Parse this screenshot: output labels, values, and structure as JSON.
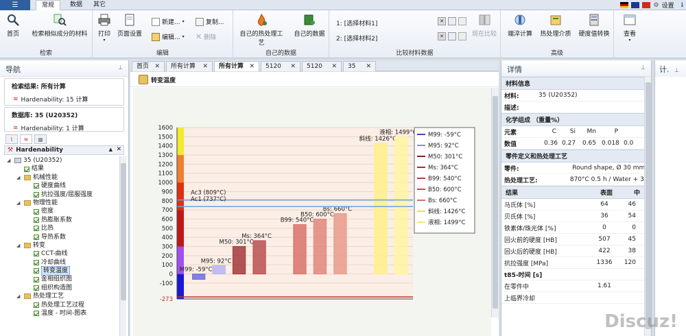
{
  "ribbon_tabs": [
    "常规",
    "数据",
    "其它"
  ],
  "settings_label": "设置",
  "groups": {
    "search": {
      "title": "检索",
      "home": "首页",
      "similar": "检索相似成分的材料"
    },
    "edit": {
      "title": "编辑",
      "print": "打印",
      "page_setup": "页面设置",
      "new": "新建...",
      "copy": "复制...",
      "edit": "编辑...",
      "delete": "删除"
    },
    "mydata": {
      "title": "自己的数据",
      "my_process": "自己的热处理工艺",
      "my_data": "自己的数据"
    },
    "compare": {
      "title": "比较材料数据",
      "slot1": "1: [选择材料1]",
      "slot2": "2: [选择材料2]",
      "compare_now": "现在比较"
    },
    "advanced": {
      "title": "高级",
      "quench": "端淬计算",
      "medium": "热处理介质",
      "hardness": "硬度值转换"
    },
    "view": {
      "label": "查看"
    }
  },
  "nav": {
    "title": "导航",
    "search_result_title": "检索结果: 所有计算",
    "search_result_item": "Hardenability: 15 计算",
    "db_title": "数据库: 35 (U20352)",
    "db_item": "Hardenability: 1 计算",
    "tree_header": "Hardenability",
    "tree": [
      {
        "level": 0,
        "type": "doc",
        "label": "35 (U20352)",
        "exp": "◢"
      },
      {
        "level": 1,
        "type": "cb",
        "label": "结果"
      },
      {
        "level": 1,
        "type": "folder",
        "label": "机械性能",
        "exp": "◢"
      },
      {
        "level": 2,
        "type": "cb",
        "label": "硬度曲线"
      },
      {
        "level": 2,
        "type": "cb",
        "label": "抗拉强度/屈服强度"
      },
      {
        "level": 1,
        "type": "folder",
        "label": "物理性能",
        "exp": "◢"
      },
      {
        "level": 2,
        "type": "cb",
        "label": "密度"
      },
      {
        "level": 2,
        "type": "cb",
        "label": "热膨胀系数"
      },
      {
        "level": 2,
        "type": "cb",
        "label": "比热"
      },
      {
        "level": 2,
        "type": "cb",
        "label": "导热系数"
      },
      {
        "level": 1,
        "type": "folder",
        "label": "转变",
        "exp": "◢"
      },
      {
        "level": 2,
        "type": "cb",
        "label": "CCT-曲线"
      },
      {
        "level": 2,
        "type": "cb",
        "label": "冷却曲线"
      },
      {
        "level": 2,
        "type": "cb",
        "label": "转变温度",
        "selected": true
      },
      {
        "level": 2,
        "type": "cb",
        "label": "金相组织图"
      },
      {
        "level": 2,
        "type": "cb",
        "label": "组织构造图"
      },
      {
        "level": 1,
        "type": "folder",
        "label": "热处理工艺",
        "exp": "◢"
      },
      {
        "level": 2,
        "type": "cb",
        "label": "热处理工艺过程"
      },
      {
        "level": 2,
        "type": "cb",
        "label": "温度 - 时间-图表"
      }
    ]
  },
  "doc_tabs": [
    {
      "label": "首页",
      "active": false
    },
    {
      "label": "所有计算",
      "active": false
    },
    {
      "label": "所有计算",
      "active": true
    },
    {
      "label": "5120",
      "active": false
    },
    {
      "label": "5120",
      "active": false
    },
    {
      "label": "35",
      "active": false
    }
  ],
  "content_title": "转变温度",
  "chart_data": {
    "type": "bar",
    "ylim": [
      -273,
      1600
    ],
    "yticks": [
      -273,
      -100,
      0,
      100,
      200,
      300,
      400,
      500,
      600,
      700,
      800,
      900,
      1000,
      1100,
      1200,
      1300,
      1400,
      1500,
      1600
    ],
    "bars": [
      {
        "name": "M99",
        "value": -59,
        "color": "#6d6ee0",
        "label": "M99: -59°C"
      },
      {
        "name": "M95",
        "value": 92,
        "color": "#b8b4f0",
        "label": "M95: 92°C"
      },
      {
        "name": "M50",
        "value": 301,
        "color": "#a23a3a",
        "label": "M50: 301°C"
      },
      {
        "name": "Ms",
        "value": 364,
        "color": "#b85050",
        "label": "Ms: 364°C"
      },
      {
        "name": "B99",
        "value": 540,
        "color": "#d8736a",
        "label": "B99: 540°C"
      },
      {
        "name": "B50",
        "value": 600,
        "color": "#e0877c",
        "label": "B50: 600°C"
      },
      {
        "name": "Bs",
        "value": 660,
        "color": "#e89a8a",
        "label": "Bs: 660°C"
      },
      {
        "name": "斜线",
        "value": 1426,
        "color": "#fff08a",
        "label": "斜线: 1426°C"
      },
      {
        "name": "液相",
        "value": 1499,
        "color": "#fff4a0",
        "label": "液相: 1499°C"
      }
    ],
    "reference_lines": [
      {
        "label": "Ac3 (809°C)",
        "value": 809,
        "color": "#6ea0e0"
      },
      {
        "label": "Ac1 (737°C)",
        "value": 737,
        "color": "#6ea0e0"
      }
    ],
    "zero_line_color": "#d02a2a",
    "legend": [
      {
        "label": "M99: -59°C",
        "color": "#4444cc"
      },
      {
        "label": "M95: 92°C",
        "color": "#8888dd"
      },
      {
        "label": "M50: 301°C",
        "color": "#8a2020"
      },
      {
        "label": "Ms: 364°C",
        "color": "#a03030"
      },
      {
        "label": "B99: 540°C",
        "color": "#b04040"
      },
      {
        "label": "B50: 600°C",
        "color": "#c05050"
      },
      {
        "label": "Bs: 660°C",
        "color": "#d07060"
      },
      {
        "label": "斜线: 1426°C",
        "color": "#f0e040"
      },
      {
        "label": "液相: 1499°C",
        "color": "#f6ea70"
      }
    ],
    "legend_position": "top-right",
    "scale_colors": [
      {
        "from": -273,
        "to": 0,
        "color": "#1818d8"
      },
      {
        "from": 0,
        "to": 300,
        "color": "#a050f0"
      },
      {
        "from": 300,
        "to": 700,
        "color": "#c01818"
      },
      {
        "from": 700,
        "to": 1000,
        "color": "#e03010"
      },
      {
        "from": 1000,
        "to": 1300,
        "color": "#f08030"
      },
      {
        "from": 1300,
        "to": 1600,
        "color": "#f4ea30"
      }
    ]
  },
  "details": {
    "title": "详情",
    "material_info_title": "材料信息",
    "material_label": "材料:",
    "material_value": "35 (U20352)",
    "desc_label": "描述:",
    "chem_title": "化学组成 （重量%）",
    "chem_header": [
      "元素",
      "C",
      "Si",
      "Mn",
      "P"
    ],
    "chem_values": [
      "数值",
      "0.36",
      "0.27",
      "0.65",
      "0.018",
      "0.0"
    ],
    "process_title": "零件定义和热处理工艺",
    "part_label": "零件:",
    "part_value": "Round shape, Ø 30 mm",
    "heat_label": "热处理工艺:",
    "heat_value": "870°C 0.5 h / Water + 36",
    "result_title": "结果",
    "result_col1": "表面",
    "result_col2": "中",
    "results": [
      {
        "label": "马氏体 [%]",
        "v1": "64",
        "v2": "46"
      },
      {
        "label": "贝氏体 [%]",
        "v1": "36",
        "v2": "54"
      },
      {
        "label": "铁素体/珠光体 [%]",
        "v1": "0",
        "v2": "0"
      },
      {
        "label": "回火前的硬度 [HB]",
        "v1": "507",
        "v2": "45"
      },
      {
        "label": "回火后的硬度 [HB]",
        "v1": "422",
        "v2": "38"
      },
      {
        "label": "抗拉强度 [MPa]",
        "v1": "1336",
        "v2": "120"
      }
    ],
    "t85_title": "t85-时间 [s]",
    "t85_rows": [
      {
        "label": "在零件中",
        "v1": "1.61"
      },
      {
        "label": "上临界冷却",
        "v1": ""
      }
    ]
  },
  "calc_panel_title": "计.",
  "watermark": "Discuz!"
}
